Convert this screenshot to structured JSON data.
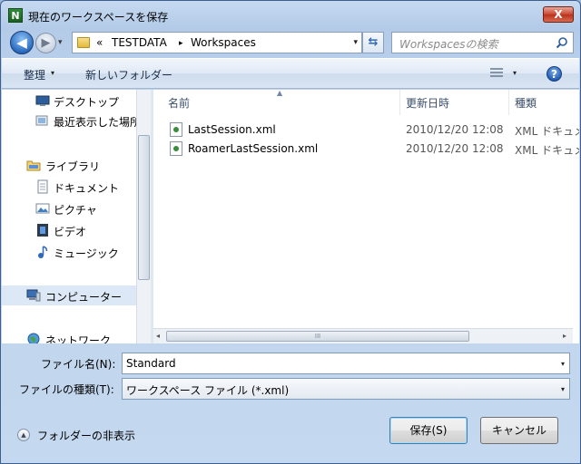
{
  "window": {
    "title": "現在のワークスペースを保存",
    "close_glyph": "X"
  },
  "nav": {
    "history_glyph": "▾",
    "back_glyph": "◀",
    "forward_glyph": "▶"
  },
  "address": {
    "overflow": "«",
    "segments": [
      "TESTDATA",
      "Workspaces"
    ],
    "separator": "▸",
    "dropdown_glyph": "▾"
  },
  "search": {
    "placeholder": "Workspacesの検索"
  },
  "toolbar": {
    "organize_label": "整理",
    "organize_caret": "▾",
    "new_folder_label": "新しいフォルダー",
    "view_caret": "▾",
    "help_glyph": "?"
  },
  "sidebar": {
    "items": [
      {
        "label": "デスクトップ",
        "icon": "desktop-icon"
      },
      {
        "label": "最近表示した場所",
        "icon": "recent-places-icon"
      },
      {
        "label": "ライブラリ",
        "icon": "library-icon"
      },
      {
        "label": "ドキュメント",
        "icon": "documents-icon"
      },
      {
        "label": "ピクチャ",
        "icon": "pictures-icon"
      },
      {
        "label": "ビデオ",
        "icon": "videos-icon"
      },
      {
        "label": "ミュージック",
        "icon": "music-icon"
      },
      {
        "label": "コンピューター",
        "icon": "computer-icon"
      },
      {
        "label": "ネットワーク",
        "icon": "network-icon"
      }
    ],
    "selected": "コンピューター"
  },
  "files": {
    "columns": [
      "名前",
      "更新日時",
      "種類"
    ],
    "rows": [
      {
        "name": "LastSession.xml",
        "modified": "2010/12/20 12:08",
        "type": "XML ドキュメント"
      },
      {
        "name": "RoamerLastSession.xml",
        "modified": "2010/12/20 12:08",
        "type": "XML ドキュメント"
      }
    ],
    "scroll_left_glyph": "◂",
    "scroll_right_glyph": "▸",
    "grip_glyph": "III"
  },
  "form": {
    "filename_label": "ファイル名(N):",
    "filename_value": "Standard",
    "filetype_label": "ファイルの種類(T):",
    "filetype_value": "ワークスペース ファイル (*.xml)",
    "dropdown_glyph": "▾"
  },
  "footer": {
    "toggle_folders_label": "フォルダーの非表示",
    "toggle_glyph": "▲",
    "save_label": "保存(S)",
    "cancel_label": "キャンセル"
  }
}
